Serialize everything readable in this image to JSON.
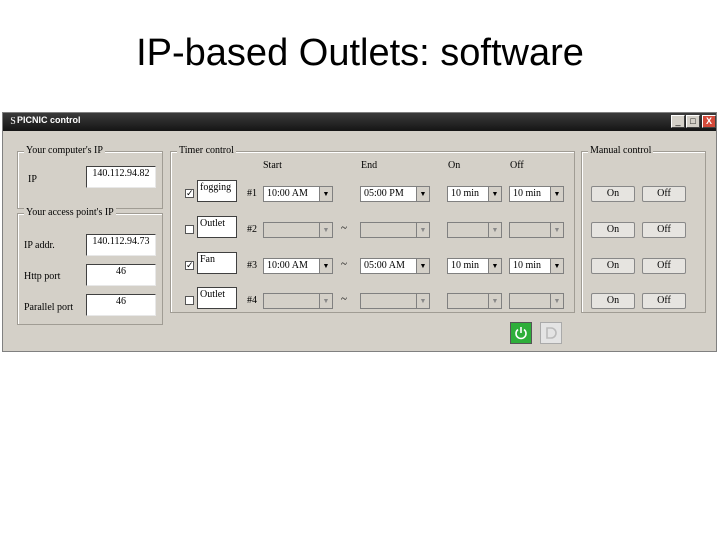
{
  "slide": {
    "title": "IP-based Outlets: software"
  },
  "window": {
    "title": "PICNIC control",
    "controls": {
      "minimize": "_",
      "maximize": "□",
      "close": "X"
    }
  },
  "computer_ip": {
    "label": "Your computer's IP",
    "ip_label": "IP",
    "ip_value": "140.112.94.82"
  },
  "access_point": {
    "label": "Your access point's IP",
    "ip_label": "IP addr.",
    "ip_value": "140.112.94.73",
    "http_label": "Http port",
    "http_value": "46",
    "parallel_label": "Parallel port",
    "parallel_value": "46"
  },
  "timer": {
    "label": "Timer control",
    "headers": {
      "start": "Start",
      "end": "End",
      "on": "On",
      "off": "Off"
    },
    "rows": [
      {
        "checked": true,
        "name": "fogging",
        "num": "#1",
        "start": "10:00 AM",
        "end": "05:00 PM",
        "on": "10 min",
        "off": "10 min",
        "sep": ""
      },
      {
        "checked": false,
        "name": "Outlet",
        "num": "#2",
        "start": "",
        "end": "",
        "on": "",
        "off": "",
        "sep": "~"
      },
      {
        "checked": true,
        "name": "Fan",
        "num": "#3",
        "start": "10:00 AM",
        "end": "05:00 AM",
        "on": "10 min",
        "off": "10 min",
        "sep": "~"
      },
      {
        "checked": false,
        "name": "Outlet",
        "num": "#4",
        "start": "",
        "end": "",
        "on": "",
        "off": "",
        "sep": "~"
      }
    ]
  },
  "manual": {
    "label": "Manual control",
    "on_label": "On",
    "off_label": "Off"
  },
  "icons": {
    "check": "✓",
    "arrow": "▼",
    "app": "S",
    "power": "power-icon"
  },
  "colors": {
    "power_on": "#2eae3a"
  }
}
